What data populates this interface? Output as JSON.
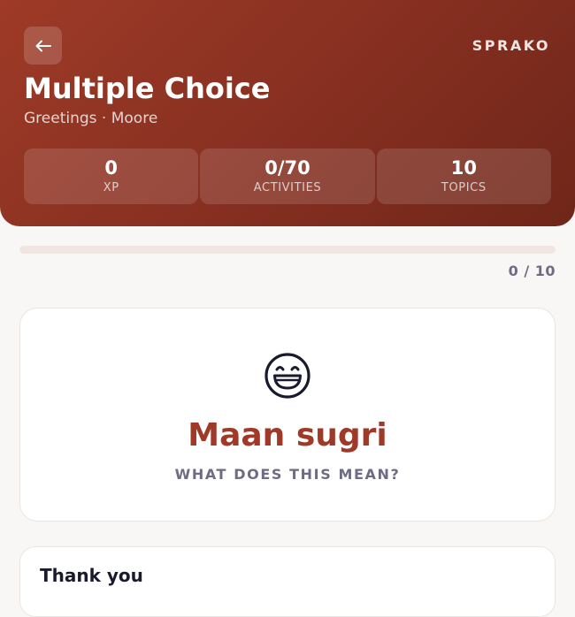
{
  "header": {
    "back_icon": "arrow-left-icon",
    "brand": "SPRAKO",
    "title": "Multiple Choice",
    "subtitle": "Greetings · Moore",
    "stats": [
      {
        "value": "0",
        "label": "XP"
      },
      {
        "value": "0/70",
        "label": "ACTIVITIES"
      },
      {
        "value": "10",
        "label": "TOPICS"
      }
    ]
  },
  "progress": {
    "text": "0 / 10",
    "fraction": 0
  },
  "question": {
    "icon": "grinning-face-icon",
    "word": "Maan sugri",
    "prompt": "WHAT DOES THIS MEAN?"
  },
  "options": [
    {
      "label": "Thank you"
    }
  ],
  "colors": {
    "accent": "#9e3a27",
    "header_gradient_start": "#9e3a27",
    "header_gradient_end": "#6f2619",
    "muted_text": "#6e6c82",
    "background": "#f9f7f5"
  }
}
